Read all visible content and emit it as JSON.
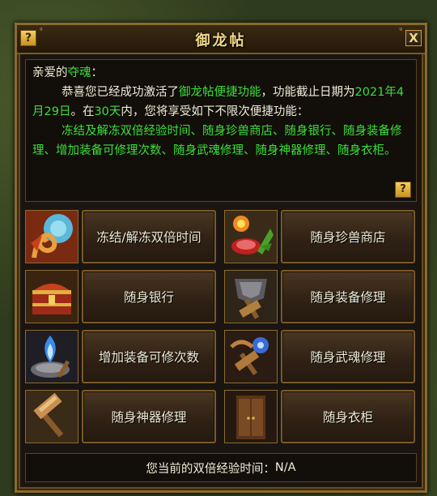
{
  "window": {
    "title": "御龙帖",
    "help_glyph": "?",
    "close_glyph": "X",
    "corner_glyph": "ᵍ"
  },
  "message": {
    "greeting": "亲爱的",
    "player_name": "夺魂",
    "greeting_colon": "：",
    "line1_a": "恭喜您已经成功激活了",
    "line1_b": "御龙帖便捷功能",
    "line1_c": "，功能截止日期为",
    "expiry_date": "2021年4月29日",
    "line2_a": "。在",
    "days": "30天",
    "line2_b": "内，您将享受如下不限次便捷功能：",
    "features_list": "冻结及解冻双倍经验时间、随身珍兽商店、随身银行、随身装备修理、增加装备可修理次数、随身武魂修理、随身神器修理、随身衣柜。"
  },
  "features": [
    {
      "label": "冻结/解冻双倍时间",
      "icon": "freeze-double-exp-icon"
    },
    {
      "label": "随身珍兽商店",
      "icon": "pet-shop-icon"
    },
    {
      "label": "随身银行",
      "icon": "treasure-chest-icon"
    },
    {
      "label": "随身装备修理",
      "icon": "armor-hammer-icon"
    },
    {
      "label": "增加装备可修次数",
      "icon": "blue-flame-anvil-icon"
    },
    {
      "label": "随身武魂修理",
      "icon": "orb-hammer-icon"
    },
    {
      "label": "随身神器修理",
      "icon": "hammer-icon"
    },
    {
      "label": "随身衣柜",
      "icon": "wardrobe-icon"
    }
  ],
  "status": {
    "label": "您当前的双倍经验时间：",
    "value": "N/A"
  },
  "colors": {
    "highlight_green": "#3adf3a",
    "title_gold": "#f2d98a",
    "frame_bronze": "#8a6a30"
  }
}
